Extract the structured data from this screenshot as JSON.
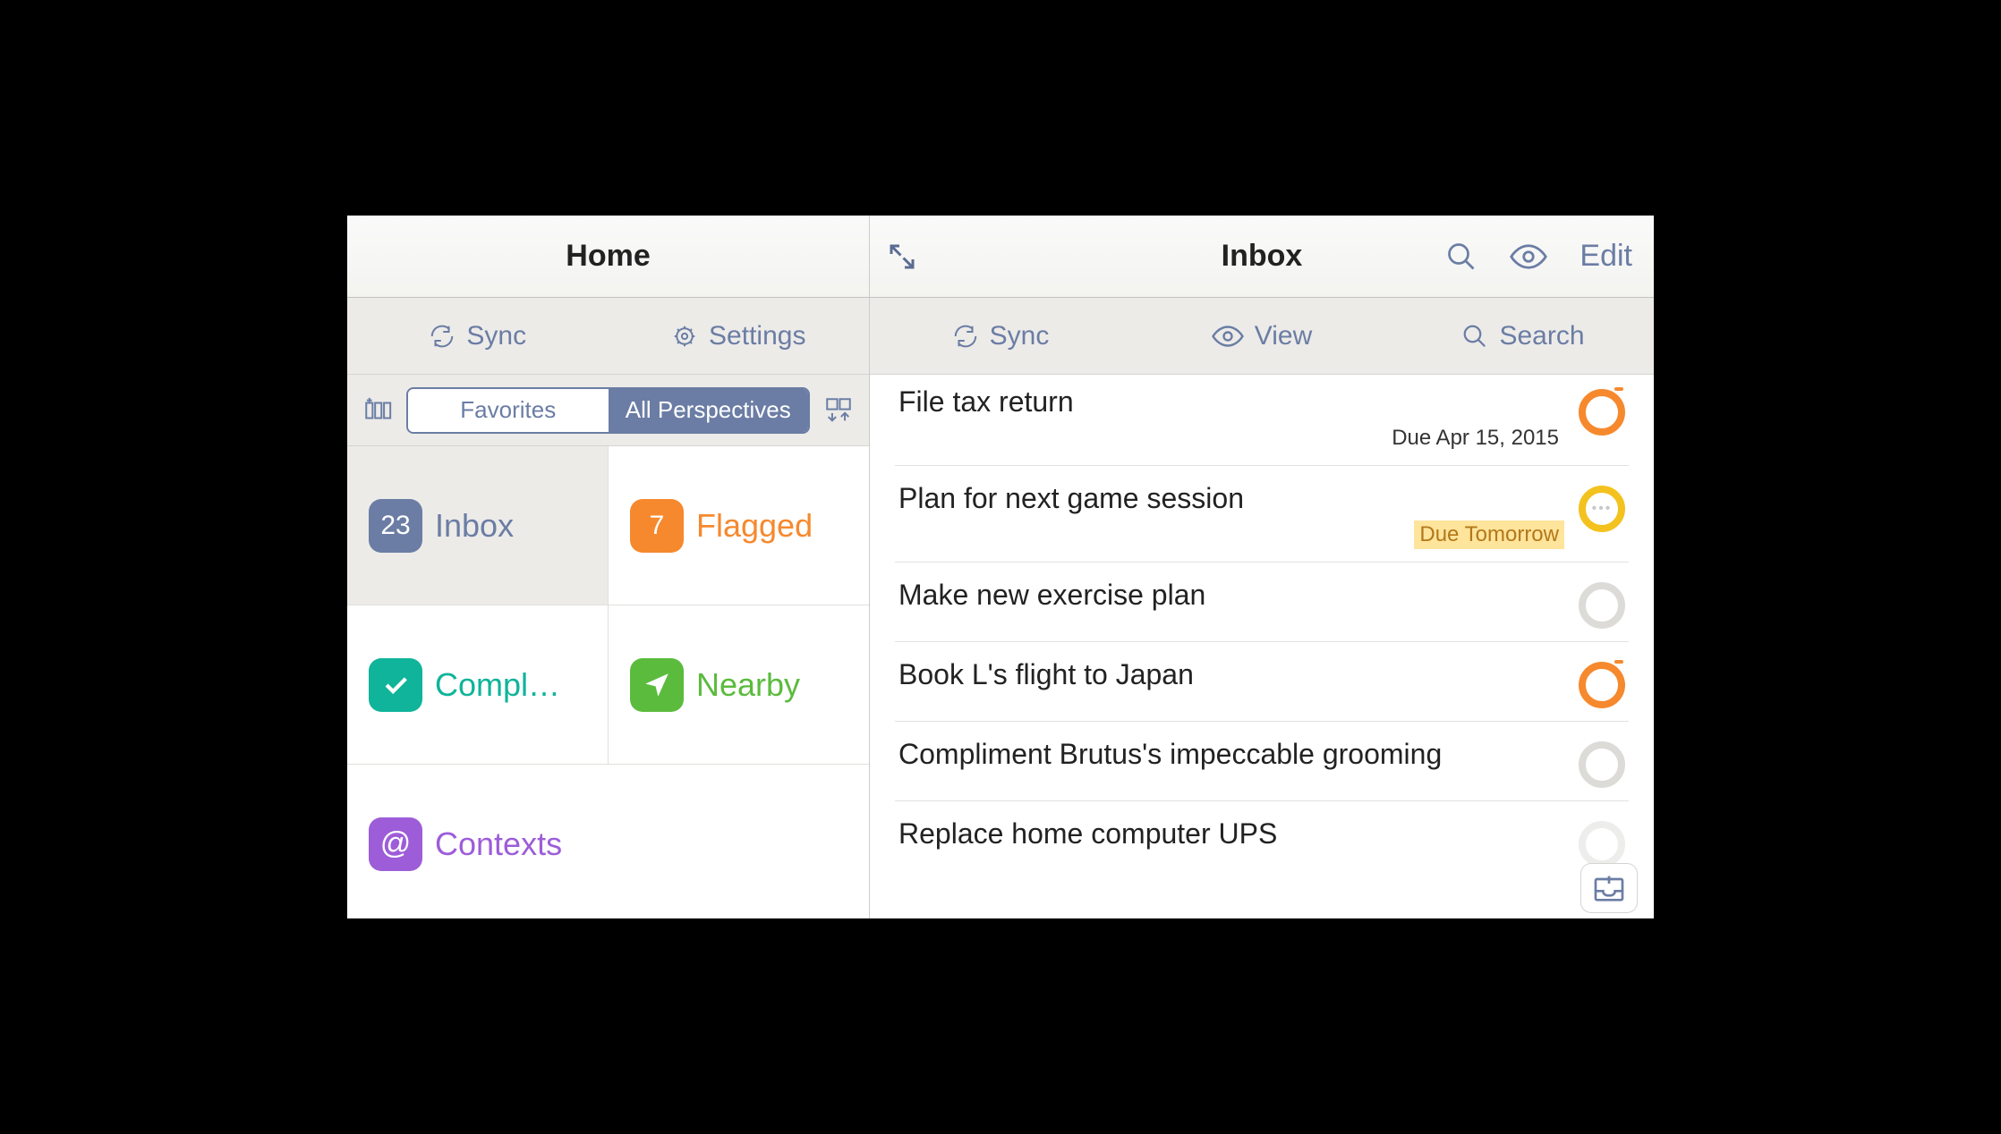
{
  "left": {
    "title": "Home",
    "toolbar": {
      "sync": "Sync",
      "settings": "Settings"
    },
    "segments": {
      "favorites": "Favorites",
      "all": "All Perspectives"
    },
    "tiles": {
      "inbox": {
        "label": "Inbox",
        "count": "23"
      },
      "flagged": {
        "label": "Flagged",
        "count": "7"
      },
      "completed": {
        "label": "Compl…"
      },
      "nearby": {
        "label": "Nearby"
      },
      "contexts": {
        "label": "Contexts"
      }
    }
  },
  "right": {
    "title": "Inbox",
    "editLabel": "Edit",
    "toolbar": {
      "sync": "Sync",
      "view": "View",
      "search": "Search"
    },
    "tasks": [
      {
        "title": "File tax return",
        "due": "Due Apr 15, 2015",
        "dueStyle": "plain",
        "status": "overdue"
      },
      {
        "title": "Plan for next game session",
        "due": "Due Tomorrow",
        "dueStyle": "hilite",
        "status": "soon"
      },
      {
        "title": "Make new exercise plan",
        "due": "",
        "dueStyle": "",
        "status": "none"
      },
      {
        "title": "Book L's flight to Japan",
        "due": "",
        "dueStyle": "",
        "status": "overdue"
      },
      {
        "title": "Compliment Brutus's impeccable grooming",
        "due": "",
        "dueStyle": "",
        "status": "none"
      },
      {
        "title": "Replace home computer UPS",
        "due": "",
        "dueStyle": "",
        "status": "none"
      }
    ]
  }
}
